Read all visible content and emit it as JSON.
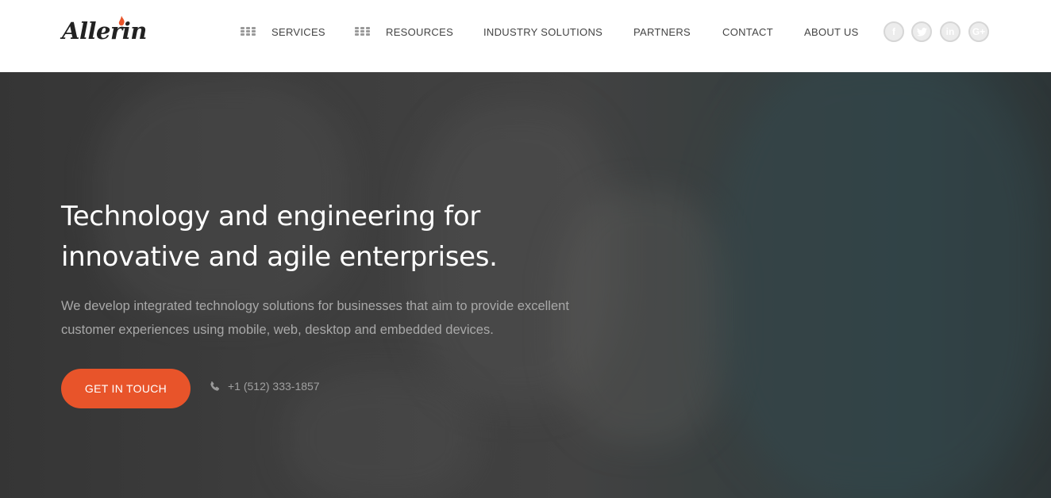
{
  "brand": {
    "name": "Allerin",
    "accent_color": "#e8542a"
  },
  "nav": {
    "items": [
      {
        "label": "SERVICES",
        "icon": "grid-icon"
      },
      {
        "label": "RESOURCES",
        "icon": "grid-icon"
      },
      {
        "label": "INDUSTRY SOLUTIONS"
      },
      {
        "label": "PARTNERS"
      },
      {
        "label": "CONTACT"
      },
      {
        "label": "ABOUT US"
      }
    ],
    "social": [
      {
        "name": "facebook-icon",
        "glyph": "f"
      },
      {
        "name": "twitter-icon",
        "glyph": ""
      },
      {
        "name": "linkedin-icon",
        "glyph": "in"
      },
      {
        "name": "googleplus-icon",
        "glyph": "G+"
      }
    ]
  },
  "hero": {
    "title_line1": "Technology and engineering for",
    "title_line2": "innovative and agile enterprises.",
    "subtitle_line1": "We develop integrated technology solutions for businesses that aim to provide excellent",
    "subtitle_line2": "customer experiences using mobile, web, desktop and embedded devices.",
    "cta_label": "GET IN TOUCH",
    "phone": "+1 (512) 333-1857",
    "phone_icon": "phone-icon"
  }
}
